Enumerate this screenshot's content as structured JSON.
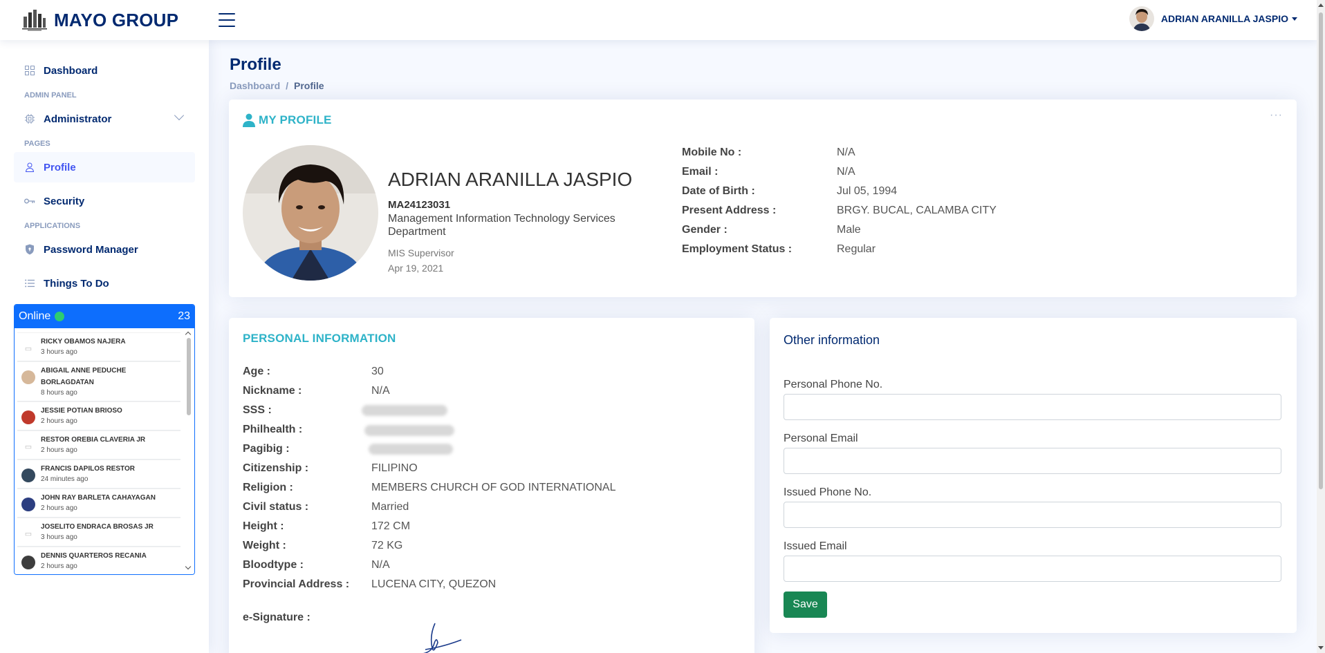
{
  "header": {
    "brand": "MAYO GROUP",
    "user_name": "ADRIAN ARANILLA JASPIO"
  },
  "sidebar": {
    "dashboard": "Dashboard",
    "heading_admin": "ADMIN PANEL",
    "administrator": "Administrator",
    "heading_pages": "PAGES",
    "profile": "Profile",
    "security": "Security",
    "heading_apps": "APPLICATIONS",
    "password_manager": "Password Manager",
    "things_to_do": "Things To Do"
  },
  "online": {
    "label": "Online",
    "count": "23",
    "users": [
      {
        "name": "RICKY OBAMOS NAJERA",
        "time": "3 hours ago"
      },
      {
        "name": "ABIGAIL ANNE PEDUCHE BORLAGDATAN",
        "time": "8 hours ago"
      },
      {
        "name": "JESSIE POTIAN BRIOSO",
        "time": "2 hours ago"
      },
      {
        "name": "RESTOR OREBIA CLAVERIA JR",
        "time": "2 hours ago"
      },
      {
        "name": "FRANCIS DAPILOS RESTOR",
        "time": "24 minutes ago"
      },
      {
        "name": "JOHN RAY BARLETA CAHAYAGAN",
        "time": "2 hours ago"
      },
      {
        "name": "JOSELITO ENDRACA BROSAS JR",
        "time": "3 hours ago"
      },
      {
        "name": "DENNIS QUARTEROS RECANIA",
        "time": "2 hours ago"
      }
    ]
  },
  "page": {
    "title": "Profile",
    "breadcrumb_home": "Dashboard",
    "breadcrumb_sep": "/",
    "breadcrumb_current": "Profile"
  },
  "profile": {
    "card_title": "MY PROFILE",
    "full_name": "ADRIAN ARANILLA JASPIO",
    "employee_id": "MA24123031",
    "department": "Management Information Technology Services Department",
    "position": "MIS Supervisor",
    "hire_date": "Apr 19, 2021",
    "details": [
      {
        "label": "Mobile No  :",
        "value": "N/A"
      },
      {
        "label": "Email  :",
        "value": "N/A"
      },
      {
        "label": "Date of Birth  :",
        "value": "Jul 05, 1994"
      },
      {
        "label": "Present Address  :",
        "value": "BRGY. BUCAL, CALAMBA CITY"
      },
      {
        "label": "Gender  :",
        "value": "Male"
      },
      {
        "label": "Employment Status  :",
        "value": "Regular"
      }
    ]
  },
  "personal": {
    "title": "PERSONAL INFORMATION",
    "rows": [
      {
        "label": "Age  :",
        "value": "30"
      },
      {
        "label": "Nickname  :",
        "value": "N/A"
      },
      {
        "label": "SSS  :",
        "value": ""
      },
      {
        "label": "Philhealth  :",
        "value": ""
      },
      {
        "label": "Pagibig  :",
        "value": ""
      },
      {
        "label": "Citizenship  :",
        "value": "FILIPINO"
      },
      {
        "label": "Religion  :",
        "value": "MEMBERS CHURCH OF GOD INTERNATIONAL"
      },
      {
        "label": "Civil status  :",
        "value": "Married"
      },
      {
        "label": "Height  :",
        "value": "172 CM"
      },
      {
        "label": "Weight  :",
        "value": "72 KG"
      },
      {
        "label": "Bloodtype  :",
        "value": "N/A"
      },
      {
        "label": "Provincial Address  :",
        "value": "LUCENA CITY, QUEZON"
      }
    ],
    "signature_label": "e-Signature  :"
  },
  "other": {
    "title": "Other information",
    "fields": [
      {
        "label": "Personal Phone No.",
        "value": ""
      },
      {
        "label": "Personal Email",
        "value": ""
      },
      {
        "label": "Issued Phone No.",
        "value": ""
      },
      {
        "label": "Issued Email",
        "value": ""
      }
    ],
    "save_label": "Save"
  }
}
